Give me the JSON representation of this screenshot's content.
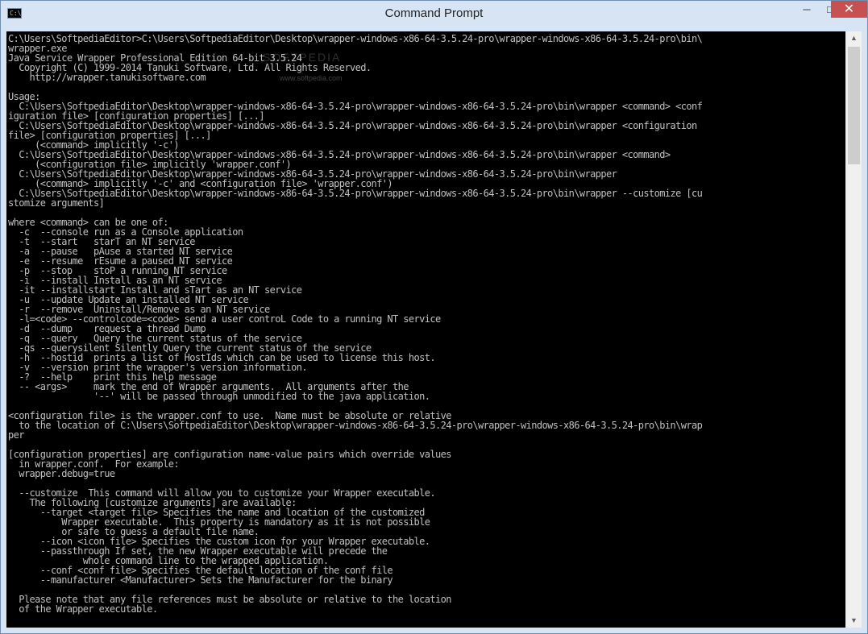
{
  "window": {
    "title": "Command Prompt",
    "icon_label": "C:\\",
    "controls": {
      "minimize": "─",
      "maximize": "□",
      "close": "✕"
    }
  },
  "console": {
    "lines": [
      "C:\\Users\\SoftpediaEditor>C:\\Users\\SoftpediaEditor\\Desktop\\wrapper-windows-x86-64-3.5.24-pro\\wrapper-windows-x86-64-3.5.24-pro\\bin\\",
      "wrapper.exe",
      "Java Service Wrapper Professional Edition 64-bit 3.5.24",
      "  Copyright (C) 1999-2014 Tanuki Software, Ltd. All Rights Reserved.",
      "    http://wrapper.tanukisoftware.com",
      "",
      "Usage:",
      "  C:\\Users\\SoftpediaEditor\\Desktop\\wrapper-windows-x86-64-3.5.24-pro\\wrapper-windows-x86-64-3.5.24-pro\\bin\\wrapper <command> <conf",
      "iguration file> [configuration properties] [...]",
      "  C:\\Users\\SoftpediaEditor\\Desktop\\wrapper-windows-x86-64-3.5.24-pro\\wrapper-windows-x86-64-3.5.24-pro\\bin\\wrapper <configuration",
      "file> [configuration properties] [...]",
      "     (<command> implicitly '-c')",
      "  C:\\Users\\SoftpediaEditor\\Desktop\\wrapper-windows-x86-64-3.5.24-pro\\wrapper-windows-x86-64-3.5.24-pro\\bin\\wrapper <command>",
      "     (<configuration file> implicitly 'wrapper.conf')",
      "  C:\\Users\\SoftpediaEditor\\Desktop\\wrapper-windows-x86-64-3.5.24-pro\\wrapper-windows-x86-64-3.5.24-pro\\bin\\wrapper",
      "     (<command> implicitly '-c' and <configuration file> 'wrapper.conf')",
      "  C:\\Users\\SoftpediaEditor\\Desktop\\wrapper-windows-x86-64-3.5.24-pro\\wrapper-windows-x86-64-3.5.24-pro\\bin\\wrapper --customize [cu",
      "stomize arguments]",
      "",
      "where <command> can be one of:",
      "  -c  --console run as a Console application",
      "  -t  --start   starT an NT service",
      "  -a  --pause   pAuse a started NT service",
      "  -e  --resume  rEsume a paused NT service",
      "  -p  --stop    stoP a running NT service",
      "  -i  --install Install as an NT service",
      "  -it --installstart Install and sTart as an NT service",
      "  -u  --update Update an installed NT service",
      "  -r  --remove  Uninstall/Remove as an NT service",
      "  -l=<code> --controlcode=<code> send a user controL Code to a running NT service",
      "  -d  --dump    request a thread Dump",
      "  -q  --query   Query the current status of the service",
      "  -qs --querysilent Silently Query the current status of the service",
      "  -h  --hostid  prints a list of HostIds which can be used to license this host.",
      "  -v  --version print the wrapper's version information.",
      "  -?  --help    print this help message",
      "  -- <args>     mark the end of Wrapper arguments.  All arguments after the",
      "                '--' will be passed through unmodified to the java application.",
      "",
      "<configuration file> is the wrapper.conf to use.  Name must be absolute or relative",
      "  to the location of C:\\Users\\SoftpediaEditor\\Desktop\\wrapper-windows-x86-64-3.5.24-pro\\wrapper-windows-x86-64-3.5.24-pro\\bin\\wrap",
      "per",
      "",
      "[configuration properties] are configuration name-value pairs which override values",
      "  in wrapper.conf.  For example:",
      "  wrapper.debug=true",
      "",
      "  --customize  This command will allow you to customize your Wrapper executable.",
      "    The following [customize arguments] are available:",
      "      --target <target file> Specifies the name and location of the customized",
      "          Wrapper executable.  This property is mandatory as it is not possible",
      "          or safe to guess a default file name.",
      "      --icon <icon file> Specifies the custom icon for your Wrapper executable.",
      "      --passthrough If set, the new Wrapper executable will precede the",
      "              whole command line to the wrapped application.",
      "      --conf <conf file> Specifies the default location of the conf file",
      "      --manufacturer <Manufacturer> Sets the Manufacturer for the binary",
      "",
      "  Please note that any file references must be absolute or relative to the location",
      "  of the Wrapper executable."
    ]
  },
  "scrollbar": {
    "up": "▲",
    "down": "▼"
  },
  "watermark": {
    "text": "SOFTPEDIA",
    "url": "www.softpedia.com"
  }
}
